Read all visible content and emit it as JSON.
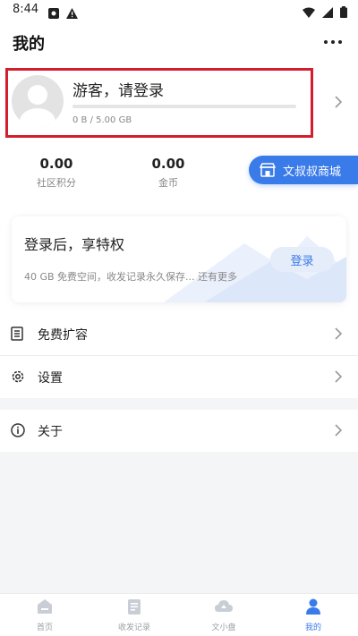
{
  "status": {
    "time": "8:44"
  },
  "header": {
    "title": "我的"
  },
  "profile": {
    "name": "游客，请登录",
    "storage_text": "0 B / 5.00 GB",
    "storage_used_fraction": 0
  },
  "stats": [
    {
      "value": "0.00",
      "label": "社区积分"
    },
    {
      "value": "0.00",
      "label": "金币"
    }
  ],
  "mall": {
    "label": "文叔叔商城"
  },
  "promo": {
    "title": "登录后，享特权",
    "desc": "40 GB 免费空间，收发记录永久保存... 还有更多",
    "button": "登录"
  },
  "menu": [
    {
      "label": "免费扩容",
      "icon": "list-icon"
    },
    {
      "label": "设置",
      "icon": "gear-icon"
    },
    {
      "label": "关于",
      "icon": "info-icon"
    }
  ],
  "nav": [
    {
      "label": "首页",
      "icon": "home-icon",
      "active": false
    },
    {
      "label": "收发记录",
      "icon": "records-icon",
      "active": false
    },
    {
      "label": "文小盘",
      "icon": "cloud-icon",
      "active": false
    },
    {
      "label": "我的",
      "icon": "person-icon",
      "active": true
    }
  ],
  "colors": {
    "accent": "#3a7bea",
    "highlight_border": "#d51e2d"
  }
}
